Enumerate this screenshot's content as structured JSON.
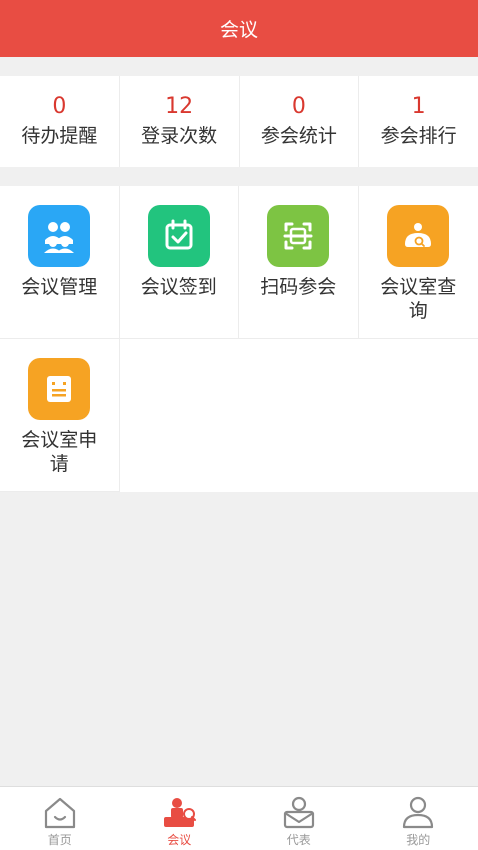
{
  "header": {
    "title": "会议"
  },
  "stats": [
    {
      "value": "0",
      "label": "待办提醒"
    },
    {
      "value": "12",
      "label": "登录次数"
    },
    {
      "value": "0",
      "label": "参会统计"
    },
    {
      "value": "1",
      "label": "参会排行"
    }
  ],
  "tiles": [
    {
      "label": "会议管理",
      "icon": "people-icon",
      "color": "#2aa7f5"
    },
    {
      "label": "会议签到",
      "icon": "calendar-check-icon",
      "color": "#22c47e"
    },
    {
      "label": "扫码参会",
      "icon": "scan-icon",
      "color": "#7dc443"
    },
    {
      "label": "会议室查询",
      "icon": "room-search-icon",
      "color": "#f6a323"
    },
    {
      "label": "会议室申请",
      "icon": "form-icon",
      "color": "#f6a323"
    }
  ],
  "tabbar": [
    {
      "label": "首页",
      "icon": "home-icon",
      "active": false
    },
    {
      "label": "会议",
      "icon": "meeting-icon",
      "active": true
    },
    {
      "label": "代表",
      "icon": "representative-icon",
      "active": false
    },
    {
      "label": "我的",
      "icon": "profile-icon",
      "active": false
    }
  ],
  "colors": {
    "primary": "#e84d43",
    "value_red": "#d9382f",
    "inactive_tab": "#999999"
  }
}
